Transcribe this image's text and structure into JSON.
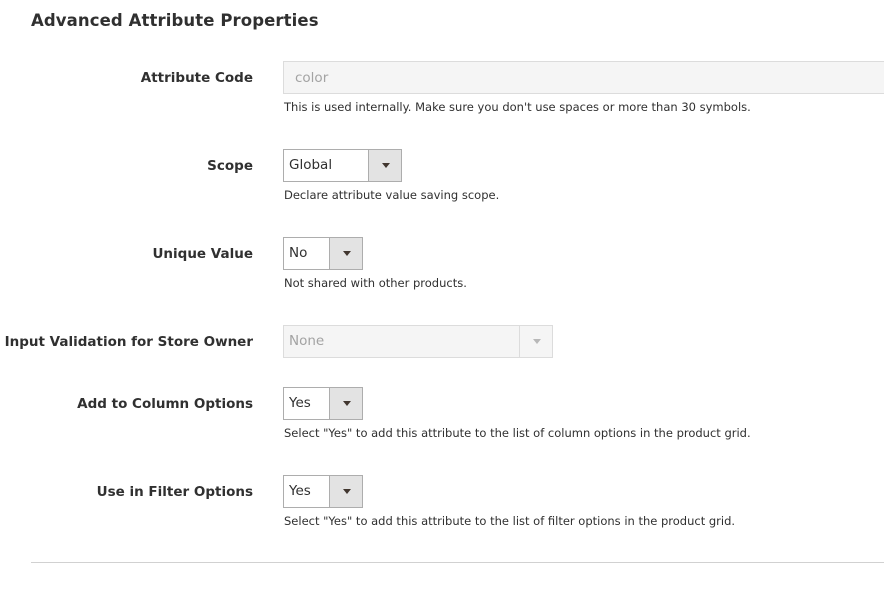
{
  "section": {
    "title": "Advanced Attribute Properties"
  },
  "fields": {
    "attribute_code": {
      "label": "Attribute Code",
      "value": "color",
      "note": "This is used internally. Make sure you don't use spaces or more than 30 symbols.",
      "disabled": true
    },
    "scope": {
      "label": "Scope",
      "value": "Global",
      "note": "Declare attribute value saving scope."
    },
    "unique_value": {
      "label": "Unique Value",
      "value": "No",
      "note": "Not shared with other products."
    },
    "input_validation": {
      "label": "Input Validation for Store Owner",
      "value": "None",
      "disabled": true
    },
    "add_to_column_options": {
      "label": "Add to Column Options",
      "value": "Yes",
      "note": "Select \"Yes\" to add this attribute to the list of column options in the product grid."
    },
    "use_in_filter_options": {
      "label": "Use in Filter Options",
      "value": "Yes",
      "note": "Select \"Yes\" to add this attribute to the list of filter options in the product grid."
    }
  },
  "icons": {
    "dropdown": "chevron-down-icon"
  },
  "colors": {
    "text": "#303030",
    "disabled_text": "#a3a3a3",
    "disabled_bg": "#f5f5f5",
    "select_border": "#adadad",
    "arrow_bg": "#e3e3e3",
    "divider": "#d1d1d1"
  }
}
